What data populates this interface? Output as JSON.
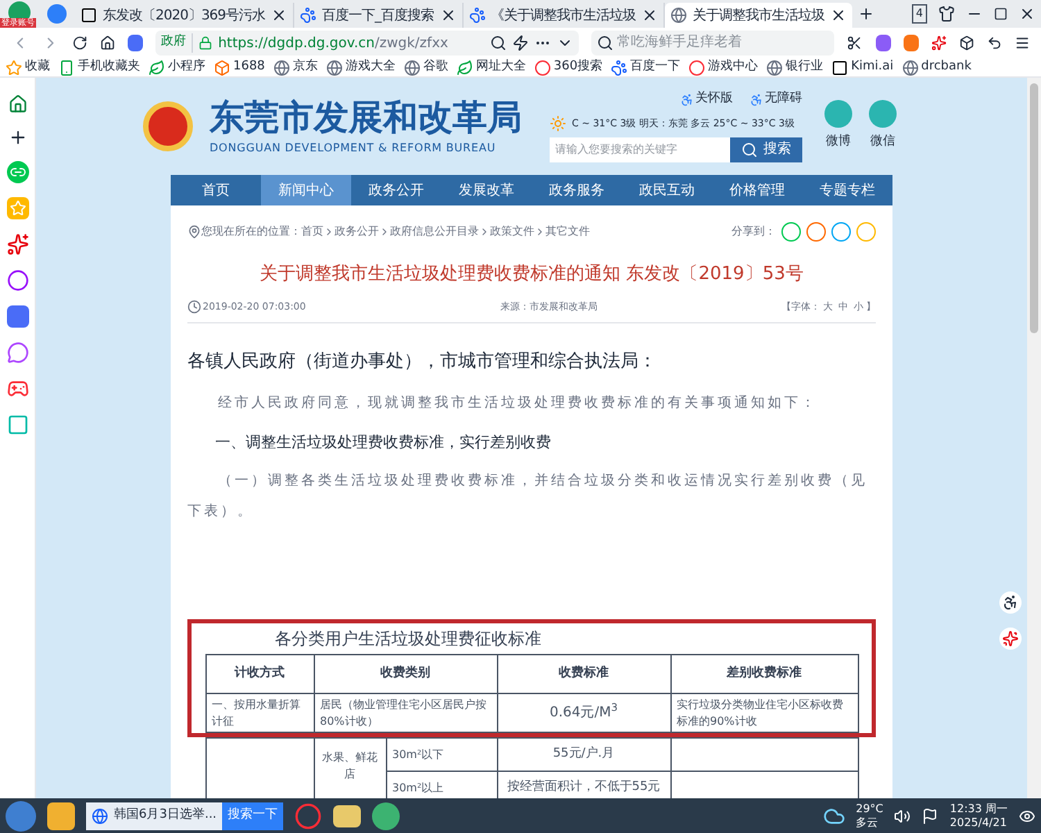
{
  "browser": {
    "badge": "登录账号",
    "tabs": [
      {
        "label": "东发改〔2020〕369号污水",
        "selected": false
      },
      {
        "label": "百度一下_百度搜索",
        "selected": false
      },
      {
        "label": "《关于调整我市生活垃圾",
        "selected": false
      },
      {
        "label": "关于调整我市生活垃圾",
        "selected": true
      }
    ],
    "tab_count": "4",
    "gov_label": "政府",
    "url_host": "https://dgdp.dg.gov.cn",
    "url_path": "/zwgk/zfxx",
    "search_placeholder": "常吃海鲜手足痒老着",
    "bookmarks": [
      "收藏",
      "手机收藏夹",
      "小程序",
      "1688",
      "京东",
      "游戏大全",
      "谷歌",
      "网址大全",
      "360搜索",
      "百度一下",
      "游戏中心",
      "银行业",
      "Kimi.ai",
      "drcbank"
    ]
  },
  "site": {
    "top_links": [
      "关怀版",
      "无障碍"
    ],
    "weather": "C ~ 31°C 3级 明天：东莞 多云 25°C ~ 33°C 3级",
    "title": "东莞市发展和改革局",
    "subtitle": "DONGGUAN DEVELOPMENT & REFORM BUREAU",
    "search_placeholder": "请输入您要搜索的关键字",
    "search_button": "搜索",
    "social": [
      "微博",
      "微信"
    ],
    "nav": [
      {
        "label": "首页",
        "selected": false
      },
      {
        "label": "新闻中心",
        "selected": true
      },
      {
        "label": "政务公开",
        "selected": false
      },
      {
        "label": "发展改革",
        "selected": false
      },
      {
        "label": "政务服务",
        "selected": false
      },
      {
        "label": "政民互动",
        "selected": false
      },
      {
        "label": "价格管理",
        "selected": false
      },
      {
        "label": "专题专栏",
        "selected": false
      }
    ]
  },
  "article": {
    "breadcrumb_label": "您现在所在的位置：",
    "breadcrumb": [
      "首页",
      "政务公开",
      "政府信息公开目录",
      "政策文件",
      "其它文件"
    ],
    "share_label": "分享到：",
    "title": "关于调整我市生活垃圾处理费收费标准的通知 东发改〔2019〕53号",
    "date": "2019-02-20 07:03:00",
    "source": "来源：市发展和改革局",
    "font_label": "【字体：",
    "font_sizes": [
      "大",
      "中",
      "小"
    ],
    "font_end": "】",
    "body": [
      {
        "kind": "salutation",
        "text": "各镇人民政府（街道办事处），市城市管理和综合执法局："
      },
      {
        "kind": "paragraph",
        "text": "经市人民政府同意，现就调整我市生活垃圾处理费收费标准的有关事项通知如下："
      },
      {
        "kind": "heading",
        "text": "一、调整生活垃圾处理费收费标准，实行差别收费"
      },
      {
        "kind": "paragraph",
        "text": "（一）调整各类生活垃圾处理费收费标准，并结合垃圾分类和收运情况实行差别收费（见下表）。"
      }
    ],
    "table": {
      "title": "各分类用户生活垃圾处理费征收标准",
      "columns": [
        "计收方式",
        "收费类别",
        "收费标准",
        "差别收费标准"
      ],
      "row_1": [
        "一、按用水量折算计征",
        "居民（物业管理住宅小区居民户按80%计收）",
        "0.64元/M$^{3}$",
        "实行垃圾分类物业住宅小区标收费标准的90%计收"
      ],
      "group": "水果、鲜花店",
      "sub_rows": [
        [
          "30m²以下",
          "55元/户.月"
        ],
        [
          "30m²以上",
          "按经营面积计，不低于55元"
        ]
      ]
    }
  },
  "taskbar": {
    "task": "韩国6月3日选举...",
    "task_button": "搜索一下",
    "temp": "29°C",
    "weather": "多云",
    "time": "12:33 周一",
    "date": "2025/4/21"
  }
}
